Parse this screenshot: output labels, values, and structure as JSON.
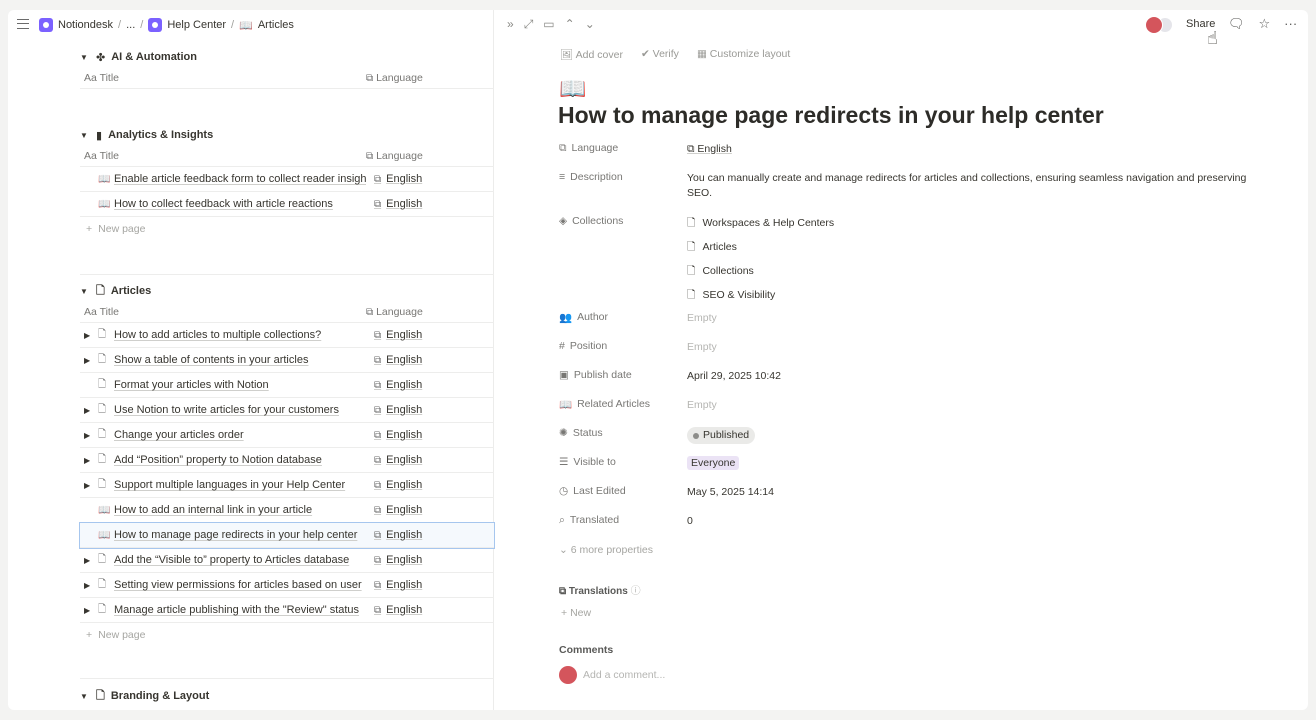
{
  "breadcrumb": {
    "workspace": "Notiondesk",
    "ellipsis": "...",
    "help_center": "Help Center",
    "articles": "Articles"
  },
  "sections": {
    "ai": {
      "title": "AI & Automation"
    },
    "analytics": {
      "title": "Analytics & Insights",
      "rows": [
        {
          "title": "Enable article feedback form to collect reader insights",
          "lang": "English"
        },
        {
          "title": "How to collect feedback with article reactions",
          "lang": "English"
        }
      ]
    },
    "articles": {
      "title": "Articles",
      "rows": [
        {
          "title": "How to add articles to multiple collections?",
          "lang": "English"
        },
        {
          "title": "Show a table of contents in your articles",
          "lang": "English"
        },
        {
          "title": "Format your articles with Notion",
          "lang": "English"
        },
        {
          "title": "Use Notion to write articles for your customers",
          "lang": "English"
        },
        {
          "title": "Change your articles order",
          "lang": "English"
        },
        {
          "title": "Add “Position” property to Notion database",
          "lang": "English"
        },
        {
          "title": "Support multiple languages in your Help Center",
          "lang": "English"
        },
        {
          "title": "How to add an internal link in your article",
          "lang": "English"
        },
        {
          "title": "How to manage page redirects in your help center",
          "lang": "English"
        },
        {
          "title": "Add the “Visible to” property to Articles database",
          "lang": "English"
        },
        {
          "title": "Setting view permissions for articles based on user",
          "lang": "English"
        },
        {
          "title": "Manage article publishing with the \"Review\" status",
          "lang": "English"
        }
      ]
    },
    "branding": {
      "title": "Branding & Layout"
    }
  },
  "table_head": {
    "title": "Title",
    "language": "Language"
  },
  "new_page": "New page",
  "topbar": {
    "share": "Share"
  },
  "page_actions": {
    "add_cover": "Add cover",
    "verify": "Verify",
    "customize": "Customize layout"
  },
  "page": {
    "title": "How to manage page redirects in your help center",
    "props": {
      "language": {
        "label": "Language",
        "value": "English"
      },
      "description": {
        "label": "Description",
        "value": "You can manually create and manage redirects for articles and collections, ensuring seamless navigation and preserving SEO."
      },
      "collections": {
        "label": "Collections",
        "items": [
          "Workspaces & Help Centers",
          "Articles",
          "Collections",
          "SEO & Visibility"
        ]
      },
      "author": {
        "label": "Author",
        "value": "Empty"
      },
      "position": {
        "label": "Position",
        "value": "Empty"
      },
      "publish_date": {
        "label": "Publish date",
        "value": "April 29, 2025 10:42"
      },
      "related": {
        "label": "Related Articles",
        "value": "Empty"
      },
      "status": {
        "label": "Status",
        "value": "Published"
      },
      "visible_to": {
        "label": "Visible to",
        "value": "Everyone"
      },
      "last_edited": {
        "label": "Last Edited",
        "value": "May 5, 2025 14:14"
      },
      "translated": {
        "label": "Translated",
        "value": "0"
      }
    },
    "more_props": "6 more properties",
    "translations": "Translations",
    "new": "New",
    "comments": "Comments",
    "add_comment": "Add a comment..."
  }
}
